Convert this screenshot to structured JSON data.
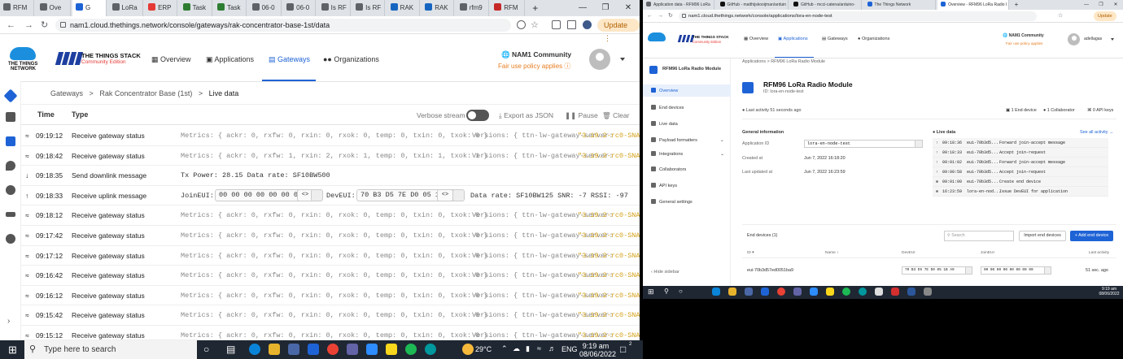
{
  "left_window": {
    "tabs": [
      {
        "label": "RFM"
      },
      {
        "label": "Ove"
      },
      {
        "label": "G"
      },
      {
        "label": "LoRa"
      },
      {
        "label": "ERP"
      },
      {
        "label": "Task"
      },
      {
        "label": "Task"
      },
      {
        "label": "06-0"
      },
      {
        "label": "06-0"
      },
      {
        "label": "Is RF"
      },
      {
        "label": "Is RF"
      },
      {
        "label": "RAK"
      },
      {
        "label": "RAK"
      },
      {
        "label": "rfm9"
      },
      {
        "label": "RFM"
      }
    ],
    "new_tab": "+",
    "url": "nam1.cloud.thethings.network/console/gateways/rak-concentrator-base-1st/data",
    "update_label": "Update",
    "header": {
      "brand_line1": "THE THINGS STACK",
      "brand_line2": "Community Edition",
      "ttn_name_1": "THE THINGS",
      "ttn_name_2": "NETWORK",
      "nav": [
        "Overview",
        "Applications",
        "Gateways",
        "Organizations"
      ],
      "cluster": "NAM1 Community",
      "fair_use": "Fair use policy applies"
    },
    "breadcrumb": [
      "Gateways",
      "Rak Concentrator Base (1st)",
      "Live data"
    ],
    "table": {
      "col_time": "Time",
      "col_type": "Type",
      "verbose_label": "Verbose stream",
      "export_label": "Export as JSON",
      "pause_label": "Pause",
      "clear_label": "Clear",
      "rows": [
        {
          "time": "09:19:12",
          "type": "Receive gateway status",
          "metrics": "Metrics: { ackr: 0, rxfw: 0, rxin: 0, rxok: 0, temp: 0, txin: 0, txok: 0 }",
          "versions": "Versions: { ttn-lw-gateway-server:",
          "ver": "\"3.19.2-rc0-SNAP"
        },
        {
          "time": "09:18:42",
          "type": "Receive gateway status",
          "metrics": "Metrics: { ackr: 0, rxfw: 1, rxin: 2, rxok: 1, temp: 0, txin: 1, txok: 1 }",
          "versions": "Versions: { ttn-lw-gateway-server:",
          "ver": "\"3.19.2-rc0-SNAP"
        },
        {
          "time": "09:18:35",
          "type": "Send downlink message",
          "extra": "Tx Power: 28.15  Data rate: SF10BW500"
        },
        {
          "time": "09:18:33",
          "type": "Receive uplink message",
          "join_label": "JoinEUI:",
          "join_eui": "00 00 00 00 00 00 00 00",
          "dev_label": "DevEUI:",
          "dev_eui": "70 B3 D5 7E D0 05 1B A9",
          "uplink_info": "Data rate: SF10BW125  SNR: -7  RSSI: -97"
        },
        {
          "time": "09:18:12",
          "type": "Receive gateway status",
          "metrics": "Metrics: { ackr: 0, rxfw: 0, rxin: 0, rxok: 0, temp: 0, txin: 0, txok: 0 }",
          "versions": "Versions: { ttn-lw-gateway-server:",
          "ver": "\"3.19.2-rc0-SNAP"
        },
        {
          "time": "09:17:42",
          "type": "Receive gateway status",
          "metrics": "Metrics: { ackr: 0, rxfw: 0, rxin: 0, rxok: 0, temp: 0, txin: 0, txok: 0 }",
          "versions": "Versions: { ttn-lw-gateway-server:",
          "ver": "\"3.19.2-rc0-SNAP"
        },
        {
          "time": "09:17:12",
          "type": "Receive gateway status",
          "metrics": "Metrics: { ackr: 0, rxfw: 0, rxin: 0, rxok: 0, temp: 0, txin: 0, txok: 0 }",
          "versions": "Versions: { ttn-lw-gateway-server:",
          "ver": "\"3.19.2-rc0-SNAP"
        },
        {
          "time": "09:16:42",
          "type": "Receive gateway status",
          "metrics": "Metrics: { ackr: 0, rxfw: 0, rxin: 0, rxok: 0, temp: 0, txin: 0, txok: 0 }",
          "versions": "Versions: { ttn-lw-gateway-server:",
          "ver": "\"3.19.2-rc0-SNAP"
        },
        {
          "time": "09:16:12",
          "type": "Receive gateway status",
          "metrics": "Metrics: { ackr: 0, rxfw: 0, rxin: 0, rxok: 0, temp: 0, txin: 0, txok: 0 }",
          "versions": "Versions: { ttn-lw-gateway-server:",
          "ver": "\"3.19.2-rc0-SNAP"
        },
        {
          "time": "09:15:42",
          "type": "Receive gateway status",
          "metrics": "Metrics: { ackr: 0, rxfw: 0, rxin: 0, rxok: 0, temp: 0, txin: 0, txok: 0 }",
          "versions": "Versions: { ttn-lw-gateway-server:",
          "ver": "\"3.19.2-rc0-SNAP"
        },
        {
          "time": "09:15:12",
          "type": "Receive gateway status",
          "metrics": "Metrics: { ackr: 0, rxfw: 0, rxin: 0, rxok: 0, temp: 0, txin: 0, txok: 0 }",
          "versions": "Versions: { ttn-lw-gateway-server:",
          "ver": "\"3.19.2-rc0-SNAP"
        }
      ]
    }
  },
  "right_window": {
    "tabs": [
      {
        "label": "Application data - RFM96 LoRa"
      },
      {
        "label": "GitHub - matthijskooijman/arduin"
      },
      {
        "label": "GitHub - mcci-catena/arduino-"
      },
      {
        "label": "The Things Network"
      },
      {
        "label": "Overview - RFM96 LoRa Radio I"
      }
    ],
    "url": "nam1.cloud.thethings.network/console/applications/lora-en-node-test",
    "update_label": "Update",
    "header": {
      "brand_line1": "THE THINGS STACK",
      "brand_line2": "Community Edition",
      "nav": [
        "Overview",
        "Applications",
        "Gateways",
        "Organizations"
      ],
      "cluster": "NAM1 Community",
      "fair_use": "Fair use policy applies",
      "username": "adellagas"
    },
    "sidebar": {
      "app_name": "RFM96 LoRa Radio Module",
      "items": [
        "Overview",
        "End devices",
        "Live data",
        "Payload formatters",
        "Integrations",
        "Collaborators",
        "API keys",
        "General settings"
      ],
      "hide_label": "Hide sidebar"
    },
    "breadcrumb": [
      "Applications",
      "RFM96 LoRa Radio Module"
    ],
    "app": {
      "title": "RFM96 LoRa Radio Module",
      "id_line": "ID: lora-en-node-test",
      "last_activity": "Last activity 51 seconds ago",
      "end_device_count": "1 End device",
      "collaborator_count": "1 Collaborator",
      "api_key_count": "0 API keys"
    },
    "general": {
      "heading": "General information",
      "app_id_label": "Application ID",
      "app_id_value": "lora-en-node-test",
      "created_label": "Created at",
      "created_value": "Jun 7, 2022 16:18:20",
      "updated_label": "Last updated at",
      "updated_value": "Jun 7, 2022 16:23:59"
    },
    "live": {
      "heading": "Live data",
      "see_all": "See all activity →",
      "events": [
        {
          "time": "09:18:36",
          "dev": "eui-70b3d5...",
          "msg": "Forward join-accept message"
        },
        {
          "time": "09:18:33",
          "dev": "eui-70b3d5...",
          "msg": "Accept join-request"
        },
        {
          "time": "09:01:02",
          "dev": "eui-70b3d5...",
          "msg": "Forward join-accept message"
        },
        {
          "time": "09:00:58",
          "dev": "eui-70b3d5...",
          "msg": "Accept join-request"
        },
        {
          "time": "09:01:00",
          "dev": "eui-70b3d5...",
          "msg": "Create end device"
        },
        {
          "time": "16:23:59",
          "dev": "lora-en-nod...",
          "msg": "Issue DevEUI for application"
        }
      ]
    },
    "devices": {
      "heading": "End devices (1)",
      "search_placeholder": "Search",
      "import_label": "Import end devices",
      "add_label": "+ Add end device",
      "cols": [
        "ID ▾",
        "Name ↕",
        "DevEUI",
        "JoinEUI",
        "Last activity"
      ],
      "row": {
        "id": "eui-70b3d57ed0051ba9",
        "dev_eui": "70 B3 D5 7E D0 05 1B A9",
        "join_eui": "00 00 00 00 00 00 00 00",
        "last": "51 sec. ago"
      }
    },
    "taskbar": {
      "time": "9:19 am",
      "date": "08/06/2022"
    }
  },
  "taskbar": {
    "search_placeholder": "Type here to search",
    "weather": "29°C",
    "lang": "ENG",
    "time": "9:19 am",
    "date": "08/06/2022",
    "notif_count": "2"
  }
}
